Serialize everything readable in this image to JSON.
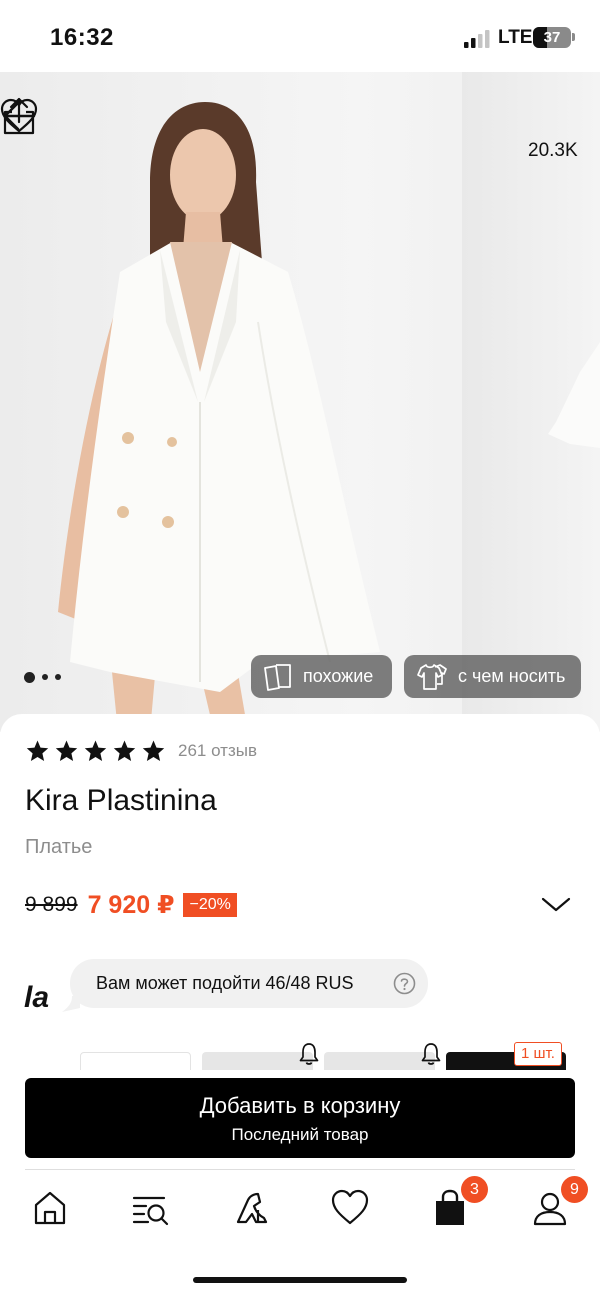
{
  "status_bar": {
    "time": "16:32",
    "network": "LTE",
    "battery": "37",
    "battery_level": 0.37
  },
  "header": {
    "like_count": "20.3K",
    "back_icon": "arrow-left-icon",
    "share_icon": "share-icon",
    "like_icon": "heart-icon"
  },
  "gallery": {
    "page_count": 3,
    "active_index": 0,
    "chips": {
      "similar_label": "похожие",
      "what_to_wear_label": "с чем носить"
    }
  },
  "product": {
    "rating_stars": 5,
    "reviews_label": "261 отзыв",
    "brand": "Kira Plastinina",
    "category": "Платье",
    "old_price": "9 899",
    "new_price": "7 920 ₽",
    "discount": "−20%"
  },
  "size_advice": {
    "logo": "la",
    "text": "Вам может подойти 46/48 RUS",
    "help_icon": "question-circle-icon"
  },
  "size_selector": {
    "stock_label": "1 шт."
  },
  "cart_button": {
    "title": "Добавить в корзину",
    "subtitle": "Последний товар"
  },
  "tabbar": {
    "items": [
      {
        "icon": "home-icon"
      },
      {
        "icon": "catalog-search-icon"
      },
      {
        "icon": "shoe-icon"
      },
      {
        "icon": "heart-icon"
      },
      {
        "icon": "shopping-bag-icon",
        "badge": "3"
      },
      {
        "icon": "profile-icon",
        "badge": "9"
      }
    ]
  },
  "colors": {
    "accent": "#f04e23",
    "text": "#111111",
    "muted": "#8d8d8d",
    "button": "#000000"
  }
}
